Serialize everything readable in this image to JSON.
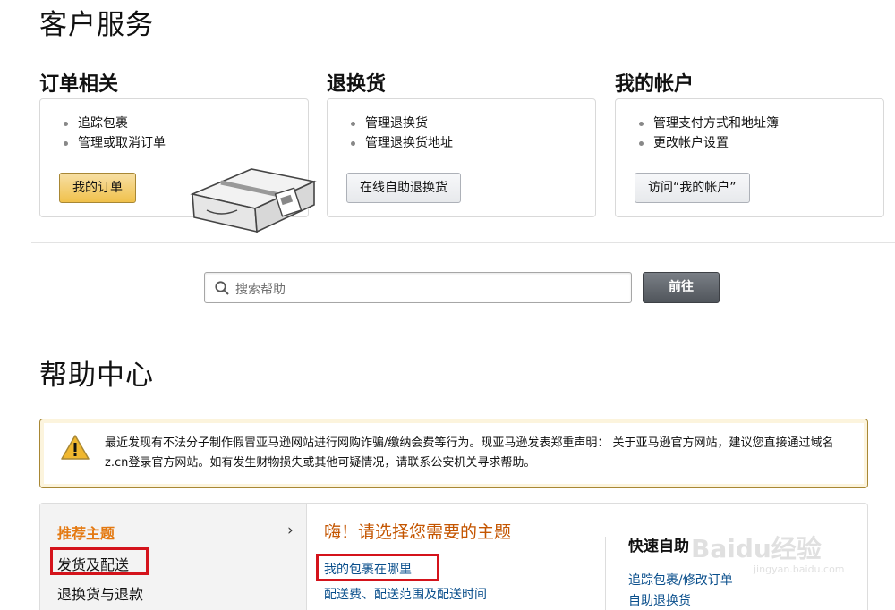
{
  "page_title": "客户服务",
  "columns": [
    {
      "title": "订单相关",
      "items": [
        "追踪包裹",
        "管理或取消订单"
      ],
      "button": "我的订单"
    },
    {
      "title": "退换货",
      "items": [
        "管理退换货",
        "管理退换货地址"
      ],
      "button": "在线自助退换货"
    },
    {
      "title": "我的帐户",
      "items": [
        "管理支付方式和地址簿",
        "更改帐户设置"
      ],
      "button": "访问“我的帐户”"
    }
  ],
  "search": {
    "placeholder": "搜索帮助",
    "button": "前往"
  },
  "help_center": {
    "title": "帮助中心",
    "alert": "最近发现有不法分子制作假冒亚马逊网站进行网购诈骗/缴纳会费等行为。现亚马逊发表郑重声明： 关于亚马逊官方网站，建议您直接通过域名z.cn登录官方网站。如有发生财物损失或其他可疑情况，请联系公安机关寻求帮助。",
    "recommended": {
      "title": "推荐主题",
      "arrow": "›",
      "items": [
        "发货及配送",
        "退换货与退款"
      ]
    },
    "middle": {
      "title": "嗨！请选择您需要的主题",
      "links": [
        "我的包裹在哪里",
        "配送费、配送范围及配送时间"
      ]
    },
    "quick": {
      "title": "快速自助",
      "links": [
        "追踪包裹/修改订单",
        "自助退换货"
      ]
    }
  },
  "watermark": {
    "text": "Baidu经验",
    "sub": "jingyan.baidu.com"
  },
  "colors": {
    "accent_orange": "#e47911",
    "link_blue": "#0a4f8c",
    "highlight_red": "#d4131b",
    "button_yellow": "#f0c14b"
  }
}
